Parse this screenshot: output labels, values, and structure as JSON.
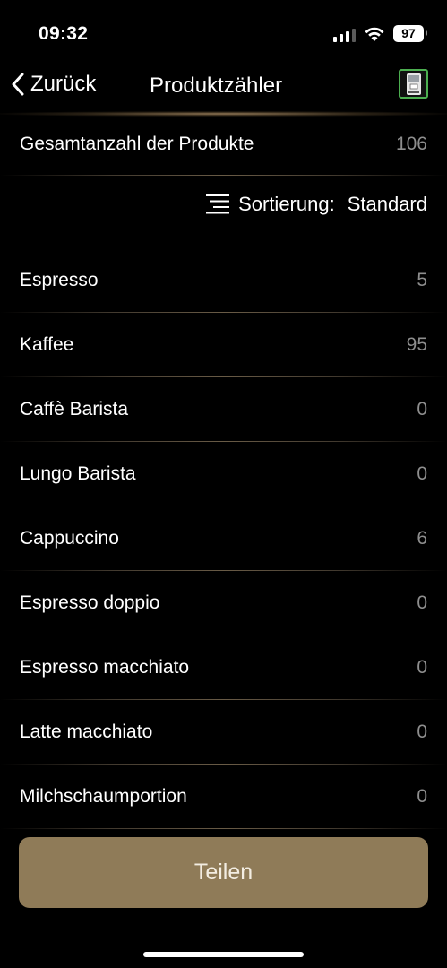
{
  "status_bar": {
    "time": "09:32",
    "battery": "97",
    "icons": [
      "signal-icon",
      "wifi-icon",
      "battery-icon"
    ]
  },
  "nav": {
    "back_label": "Zurück",
    "title": "Produktzähler",
    "device_icon": "coffee-machine-icon"
  },
  "summary": {
    "label": "Gesamtanzahl der Produkte",
    "value": "106"
  },
  "sort": {
    "label": "Sortierung:",
    "value": "Standard",
    "icon": "sort-lines-icon"
  },
  "products": [
    {
      "name": "Espresso",
      "count": "5"
    },
    {
      "name": "Kaffee",
      "count": "95"
    },
    {
      "name": "Caffè Barista",
      "count": "0"
    },
    {
      "name": "Lungo Barista",
      "count": "0"
    },
    {
      "name": "Cappuccino",
      "count": "6"
    },
    {
      "name": "Espresso doppio",
      "count": "0"
    },
    {
      "name": "Espresso macchiato",
      "count": "0"
    },
    {
      "name": "Latte macchiato",
      "count": "0"
    },
    {
      "name": "Milchschaumportion",
      "count": "0"
    }
  ],
  "actions": {
    "share_label": "Teilen"
  },
  "colors": {
    "background": "#000000",
    "accent_gold": "#8f7b58",
    "device_border": "#4caf50",
    "value_gray": "#8e8e8e"
  }
}
